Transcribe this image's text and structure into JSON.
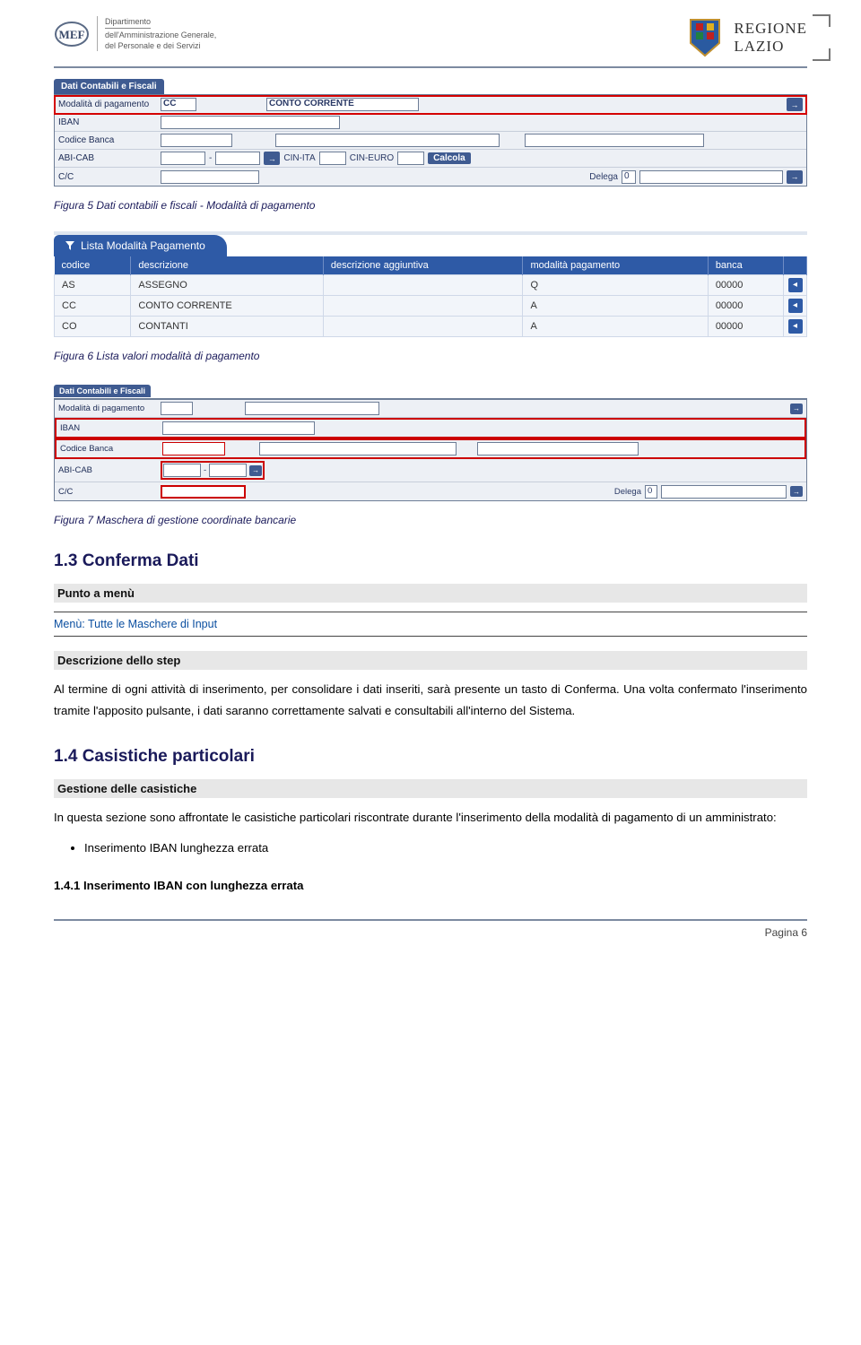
{
  "header": {
    "mef_line1": "Dipartimento",
    "mef_line2": "dell'Amministrazione Generale,",
    "mef_line3": "del Personale e dei Servizi",
    "mef_abbrev": "MEF",
    "lazio_line1": "REGIONE",
    "lazio_line2": "LAZIO"
  },
  "panel1": {
    "tab": "Dati Contabili e Fiscali",
    "rows": {
      "modalita_label": "Modalità di pagamento",
      "modalita_val1": "CC",
      "modalita_val2": "CONTO CORRENTE",
      "iban_label": "IBAN",
      "codbanca_label": "Codice Banca",
      "abicab_label": "ABI-CAB",
      "cinita_label": "CIN-ITA",
      "cineuro_label": "CIN-EURO",
      "calcola": "Calcola",
      "cc_label": "C/C",
      "delega_label": "Delega",
      "delega_val": "0"
    }
  },
  "caption1": "Figura 5 Dati contabili e fiscali - Modalità di pagamento",
  "lista": {
    "title": "Lista Modalità Pagamento",
    "headers": [
      "codice",
      "descrizione",
      "descrizione aggiuntiva",
      "modalità pagamento",
      "banca"
    ],
    "rows": [
      {
        "codice": "AS",
        "descr": "ASSEGNO",
        "agg": "",
        "mod": "Q",
        "banca": "00000"
      },
      {
        "codice": "CC",
        "descr": "CONTO CORRENTE",
        "agg": "",
        "mod": "A",
        "banca": "00000"
      },
      {
        "codice": "CO",
        "descr": "CONTANTI",
        "agg": "",
        "mod": "A",
        "banca": "00000"
      }
    ]
  },
  "caption2": "Figura 6 Lista valori modalità di pagamento",
  "panel3": {
    "tab": "Dati Contabili e Fiscali",
    "modalita_label": "Modalità di pagamento",
    "iban_label": "IBAN",
    "codbanca_label": "Codice Banca",
    "abicab_label": "ABI-CAB",
    "cc_label": "C/C",
    "delega_label": "Delega",
    "delega_val": "0"
  },
  "caption3": "Figura 7 Maschera di gestione  coordinate bancarie",
  "sec13": {
    "title": "1.3 Conferma Dati",
    "punto_label": "Punto a menù",
    "menu": "Menù: Tutte le Maschere di Input",
    "descr_label": "Descrizione dello step",
    "para": "Al termine di ogni attività di inserimento, per consolidare i dati inseriti, sarà presente un tasto di Conferma. Una volta confermato l'inserimento tramite l'apposito pulsante, i dati saranno correttamente salvati e consultabili all'interno del Sistema."
  },
  "sec14": {
    "title": "1.4 Casistiche particolari",
    "gest_label": "Gestione delle casistiche",
    "para": "In questa sezione sono affrontate le casistiche particolari riscontrate durante l'inserimento della modalità di pagamento di un amministrato:",
    "bullet1": "Inserimento IBAN lunghezza errata",
    "sub": "1.4.1   Inserimento IBAN con lunghezza errata"
  },
  "footer": {
    "page": "Pagina 6"
  }
}
